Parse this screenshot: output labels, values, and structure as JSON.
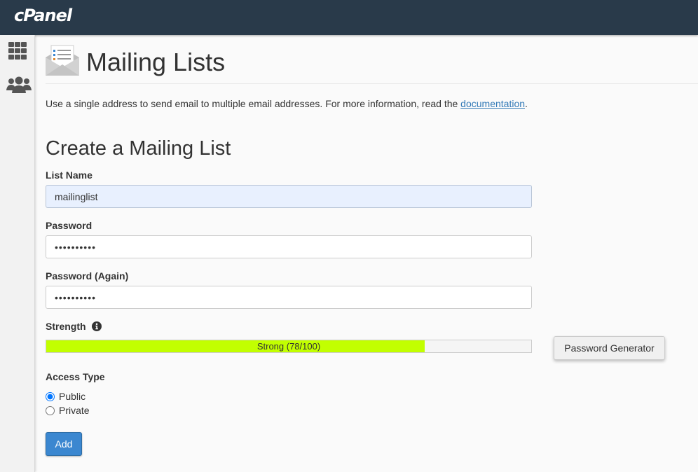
{
  "app": {
    "brand": "cPanel"
  },
  "sidebar": {
    "items": [
      {
        "icon": "grid-icon"
      },
      {
        "icon": "users-icon"
      }
    ]
  },
  "page": {
    "title": "Mailing Lists",
    "description_prefix": "Use a single address to send email to multiple email addresses. For more information, read the ",
    "description_link": "documentation",
    "description_suffix": "."
  },
  "form": {
    "section_title": "Create a Mailing List",
    "list_name": {
      "label": "List Name",
      "value": "mailinglist"
    },
    "password": {
      "label": "Password",
      "value": "••••••••••"
    },
    "password_again": {
      "label": "Password (Again)",
      "value": "••••••••••"
    },
    "strength": {
      "label": "Strength",
      "text": "Strong (78/100)",
      "score": 78,
      "max": 100,
      "color": "#c2ff00"
    },
    "generator_label": "Password Generator",
    "access_type": {
      "label": "Access Type",
      "options": [
        {
          "label": "Public",
          "checked": true
        },
        {
          "label": "Private",
          "checked": false
        }
      ]
    },
    "add_label": "Add"
  },
  "colors": {
    "topbar": "#293a4a",
    "primary": "#3b87d0",
    "link": "#337ab7"
  }
}
